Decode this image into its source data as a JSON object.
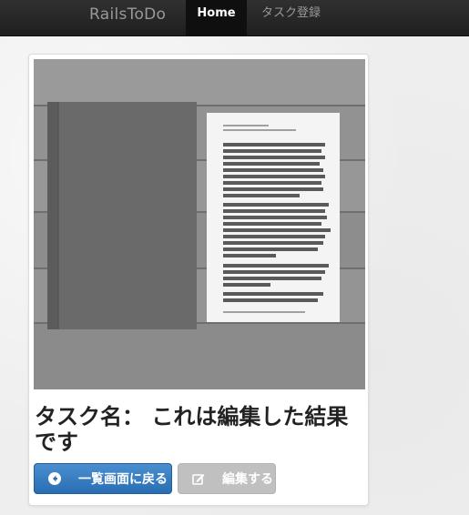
{
  "nav": {
    "brand": "RailsToDo",
    "items": [
      {
        "label": "Home",
        "active": true
      },
      {
        "label": "タスク登録",
        "active": false
      }
    ]
  },
  "task": {
    "title": "タスク名： これは編集した結果です"
  },
  "actions": {
    "back_label": "一覧画面に戻る",
    "edit_label": "編集する"
  },
  "colors": {
    "navbar": "#222222",
    "primary_button": "#337ab7",
    "disabled_button": "#c0c0c0"
  },
  "icons": {
    "back": "arrow-circle-left-icon",
    "edit": "edit-icon"
  }
}
